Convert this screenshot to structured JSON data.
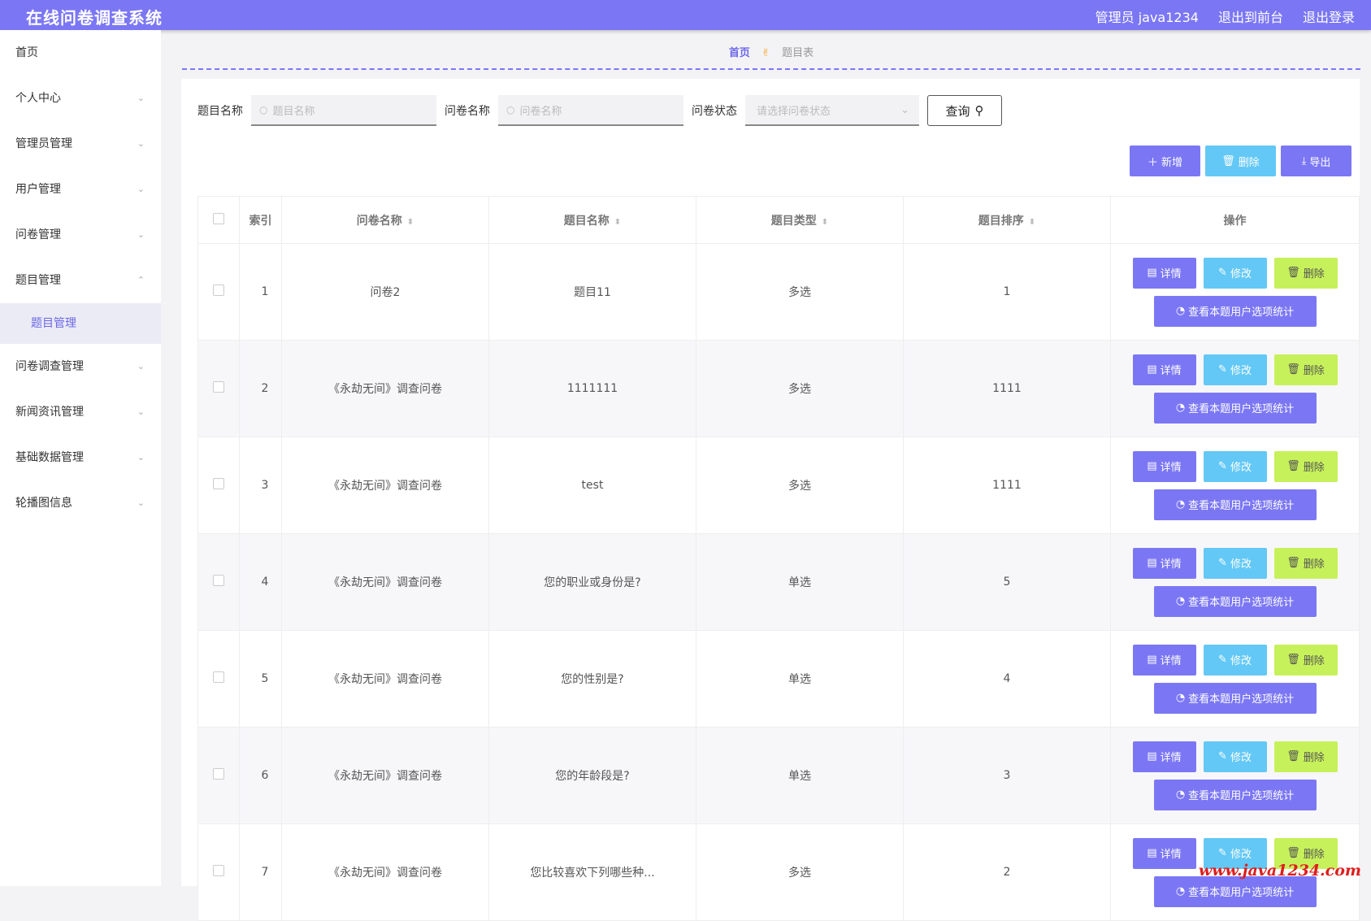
{
  "header": {
    "title": "在线问卷调查系统",
    "admin": "管理员 java1234",
    "to_front": "退出到前台",
    "logout": "退出登录"
  },
  "sidebar": {
    "items": [
      {
        "label": "首页",
        "chevron": ""
      },
      {
        "label": "个人中心",
        "chevron": "⌄"
      },
      {
        "label": "管理员管理",
        "chevron": "⌄"
      },
      {
        "label": "用户管理",
        "chevron": "⌄"
      },
      {
        "label": "问卷管理",
        "chevron": "⌄"
      },
      {
        "label": "题目管理",
        "chevron": "⌃"
      }
    ],
    "sub_item": "题目管理",
    "items_after": [
      {
        "label": "问卷调查管理",
        "chevron": "⌄"
      },
      {
        "label": "新闻资讯管理",
        "chevron": "⌄"
      },
      {
        "label": "基础数据管理",
        "chevron": "⌄"
      },
      {
        "label": "轮播图信息",
        "chevron": "⌄"
      }
    ]
  },
  "breadcrumb": {
    "home": "首页",
    "sep_icon": "hand-icon",
    "current": "题目表"
  },
  "search": {
    "label_title": "题目名称",
    "placeholder_title": "题目名称",
    "label_survey": "问卷名称",
    "placeholder_survey": "问卷名称",
    "label_status": "问卷状态",
    "placeholder_status": "请选择问卷状态",
    "query": "查询"
  },
  "toolbar": {
    "add": "新增",
    "delete": "删除",
    "export": "导出"
  },
  "table": {
    "headers": {
      "index": "索引",
      "survey": "问卷名称",
      "title": "题目名称",
      "type": "题目类型",
      "order": "题目排序",
      "ops": "操作"
    },
    "ops": {
      "detail": "详情",
      "edit": "修改",
      "remove": "删除",
      "stats": "查看本题用户选项统计"
    },
    "rows": [
      {
        "index": "1",
        "survey": "问卷2",
        "title": "题目11",
        "type": "多选",
        "order": "1"
      },
      {
        "index": "2",
        "survey": "《永劫无间》调查问卷",
        "title": "1111111",
        "type": "多选",
        "order": "1111"
      },
      {
        "index": "3",
        "survey": "《永劫无间》调查问卷",
        "title": "test",
        "type": "多选",
        "order": "1111"
      },
      {
        "index": "4",
        "survey": "《永劫无间》调查问卷",
        "title": "您的职业或身份是?",
        "type": "单选",
        "order": "5"
      },
      {
        "index": "5",
        "survey": "《永劫无间》调查问卷",
        "title": "您的性别是?",
        "type": "单选",
        "order": "4"
      },
      {
        "index": "6",
        "survey": "《永劫无间》调查问卷",
        "title": "您的年龄段是?",
        "type": "单选",
        "order": "3"
      },
      {
        "index": "7",
        "survey": "《永劫无间》调查问卷",
        "title": "您比较喜欢下列哪些种...",
        "type": "多选",
        "order": "2"
      }
    ]
  },
  "watermark": "www.java1234.com"
}
